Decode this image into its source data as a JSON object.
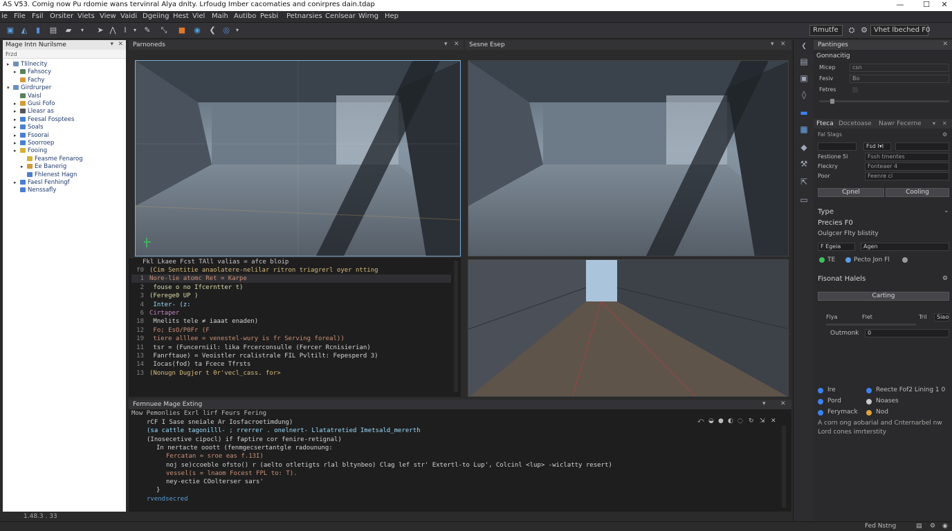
{
  "window": {
    "title": "AS V53. Comig now Pu rdomie wans tervinral Alya dnlty. Lrfoudg Imber cacomaties and conirpres dain.tdap",
    "controls": [
      "—",
      "☐",
      "✕"
    ]
  },
  "menu": [
    "ie",
    "File",
    "Fsil",
    "Orsiter",
    "Viets",
    "View",
    "Vaidi",
    "Dgeiing",
    "Hest",
    "Viel",
    "Maih",
    "Autibo",
    "Pesbi",
    "Petnarsies",
    "Cenlsear",
    "Wirng",
    "Hep"
  ],
  "toolbar": {
    "run_label": "Rmutfe",
    "search_value": "Vhet lbeched F0"
  },
  "left_panel": {
    "title": "Mage Intn Nurilsme",
    "subtitle": "Frzd",
    "items": [
      {
        "label": "Tlilnecity",
        "level": 0,
        "arrow": "▸",
        "color": "#6e8fb8"
      },
      {
        "label": "Fahsocy",
        "level": 1,
        "arrow": "▸",
        "color": "#5a7f5a"
      },
      {
        "label": "Fachy",
        "level": 1,
        "arrow": "",
        "color": "#d49a3a"
      },
      {
        "label": "Girdrurper",
        "level": 0,
        "arrow": "▾",
        "color": "#6e8fb8"
      },
      {
        "label": "Vaisl",
        "level": 1,
        "arrow": "",
        "color": "#5a7f5a"
      },
      {
        "label": "Gusi Fofo",
        "level": 1,
        "arrow": "▸",
        "color": "#d49a3a"
      },
      {
        "label": "Lleasr as",
        "level": 1,
        "arrow": "▸",
        "color": "#555"
      },
      {
        "label": "Feesal Fosptees",
        "level": 1,
        "arrow": "▸",
        "color": "#4a7fd0"
      },
      {
        "label": "Soals",
        "level": 1,
        "arrow": "▸",
        "color": "#4a7fd0"
      },
      {
        "label": "Fsoorai",
        "level": 1,
        "arrow": "▸",
        "color": "#4a7fd0"
      },
      {
        "label": "Soorroep",
        "level": 1,
        "arrow": "▸",
        "color": "#4a7fd0"
      },
      {
        "label": "Fooing",
        "level": 1,
        "arrow": "▸",
        "color": "#d4b03a"
      },
      {
        "label": "Feasme Fenarog",
        "level": 2,
        "arrow": "",
        "color": "#d4b03a"
      },
      {
        "label": "Ee Banerig",
        "level": 2,
        "arrow": "▸",
        "color": "#d49a3a"
      },
      {
        "label": "Fhlenest Hagn",
        "level": 2,
        "arrow": "",
        "color": "#4a7fd0"
      },
      {
        "label": "Faesl Fenhingf",
        "level": 1,
        "arrow": "▸",
        "color": "#4a7fd0"
      },
      {
        "label": "Nenssafly",
        "level": 1,
        "arrow": "",
        "color": "#4a7fd0"
      }
    ],
    "footer": "1.48.3 . 33"
  },
  "viewports": {
    "left_title": "Parnoneds",
    "right_title": "Sesne Esep"
  },
  "code_editor": {
    "header": "Fkl  Lkaee Fcst  TAll  valias  = afce bloip",
    "lines": [
      {
        "n": "f0",
        "text": "(Cim Sentitie anaolatere-nelilar ritron triagrerl oyer ntting",
        "color": "#d7ba7d"
      },
      {
        "n": "1",
        "text": "Nore-lie atomc Ret = Karpe",
        "color": "#ce9178"
      },
      {
        "n": "2",
        "text": "  fouse o no  Ifcerntter t)",
        "color": "#dcdcaa"
      },
      {
        "n": "3",
        "text": "(Ferege0 UP )",
        "color": "#dcdcaa"
      },
      {
        "n": "4",
        "text": "  Inter- (z:",
        "color": "#9cdcfe"
      },
      {
        "n": "6",
        "text": "Cirtaper",
        "color": "#c586c0"
      },
      {
        "n": "18",
        "text": "  Mnelits tele ≠ iaaat enaden)",
        "color": "#d4d4d4"
      },
      {
        "n": "12",
        "text": "  Fo;    EsO/P0Fr (F",
        "color": "#ce9178"
      },
      {
        "n": "19",
        "text": "  tiere alllee = venestel-wury is fr Serving foreal))",
        "color": "#ce9178"
      },
      {
        "n": "11",
        "text": "  tsr = (Funcerniil: lika Frcerconsulle (Fercer Rcnisierian)",
        "color": "#d4d4d4"
      },
      {
        "n": "13",
        "text": "  Fanrftaue)  =  Veoistler rcalistrale FIL Pvltilt: Fepesperd 3)",
        "color": "#d4d4d4"
      },
      {
        "n": "14",
        "text": "  Iocas(fod) ta Fcece Tfrsts",
        "color": "#d4d4d4"
      },
      {
        "n": "13",
        "text": "(Nonugn Dugjer t 0r'vecl_cass. for>",
        "color": "#d7ba7d"
      }
    ]
  },
  "output_panel": {
    "title": "Femnuee Mage Exting",
    "subheader": "Mow Pemonlies Exrl lirf Feurs Fering",
    "lines": [
      {
        "text": "rCF I Sase sneiale Ar Iosfacroetimdung)",
        "color": "#d4d4d4",
        "indent": 0
      },
      {
        "text": "(sa cattle tagonilll- ; rrerrer . onelnert- Llatatretied  Imetsald_mererth",
        "color": "#9cdcfe",
        "indent": 0
      },
      {
        "text": "(Inosecetive cipocl) if faptire cor fenire-retignal)",
        "color": "#d4d4d4",
        "indent": 0
      },
      {
        "text": "In nertacte ooott (fenmgecsertantgle radounung:",
        "color": "#d4d4d4",
        "indent": 1
      },
      {
        "text": "Fercatan = sroe eas f.13I)",
        "color": "#ce9178",
        "indent": 2
      },
      {
        "text": "noj se)ccoeble ofsto() r (aelto otletigts rlal bltynbeo) Clag lef str' Extertl-to Lup', Colcinl <lup> -wiclatty resert)",
        "color": "#d4d4d4",
        "indent": 2
      },
      {
        "text": "vessel(s = lnaom  Focest FPL to: T).",
        "color": "#ce9178",
        "indent": 2
      },
      {
        "text": "ney-ectie COolterser sars'",
        "color": "#d4d4d4",
        "indent": 2
      },
      {
        "text": "}",
        "color": "#d4d4d4",
        "indent": 1
      },
      {
        "text": "rvendsecred",
        "color": "#569cd6",
        "indent": 0
      }
    ]
  },
  "properties": {
    "title": "Pantinges",
    "section1": "Gonnacitig",
    "rows1": [
      {
        "label": "Micep",
        "value": "csn"
      },
      {
        "label": "Fesiv",
        "value": "Bo"
      },
      {
        "label": "Fetres",
        "value": ""
      }
    ],
    "tabs": [
      "Fteca",
      "Docetoase",
      "Nawr Fecerne"
    ],
    "subtitle": "Fal Slags",
    "grid": [
      {
        "label": "Festione 5l",
        "value": "Fssh tmentes"
      },
      {
        "label": "Fleckry",
        "value": "Fonteaer  4"
      },
      {
        "label": "Poor",
        "value": "Feenre ci"
      }
    ],
    "btn_cancel": "Cpnel",
    "btn_confirm": "Cooling",
    "type_label": "Type",
    "type_value": "Precies F0",
    "type_desc": "Oulgcer Flty blistity",
    "dropdown_a": "F Egeia",
    "dropdown_b": "Agen",
    "radio_a": "TE",
    "radio_b": "Pecto Jon Fl",
    "section2": "Fisonat Halels",
    "section2_btn": "Carting",
    "slider_labels": [
      "Flya",
      "Flet",
      "Tril",
      "Siao"
    ],
    "outmark_label": "Outmonk",
    "outmark_value": "0",
    "legend": [
      {
        "label": "Ire",
        "color": "#3b82f6"
      },
      {
        "label": "Reecte Fof2 Lining 1 0",
        "color": "#3b82f6"
      },
      {
        "label": "Pord",
        "color": "#3b82f6"
      },
      {
        "label": "Noases",
        "color": "#c9c9c9"
      },
      {
        "label": "Ferymack",
        "color": "#3b82f6"
      },
      {
        "label": "Nod",
        "color": "#e3a33a"
      }
    ],
    "footer_desc": "A corn ong aobarial and Cnternarbel nw Lord cones imrterstity"
  },
  "statusbar": {
    "right": "Fed Nstng"
  }
}
